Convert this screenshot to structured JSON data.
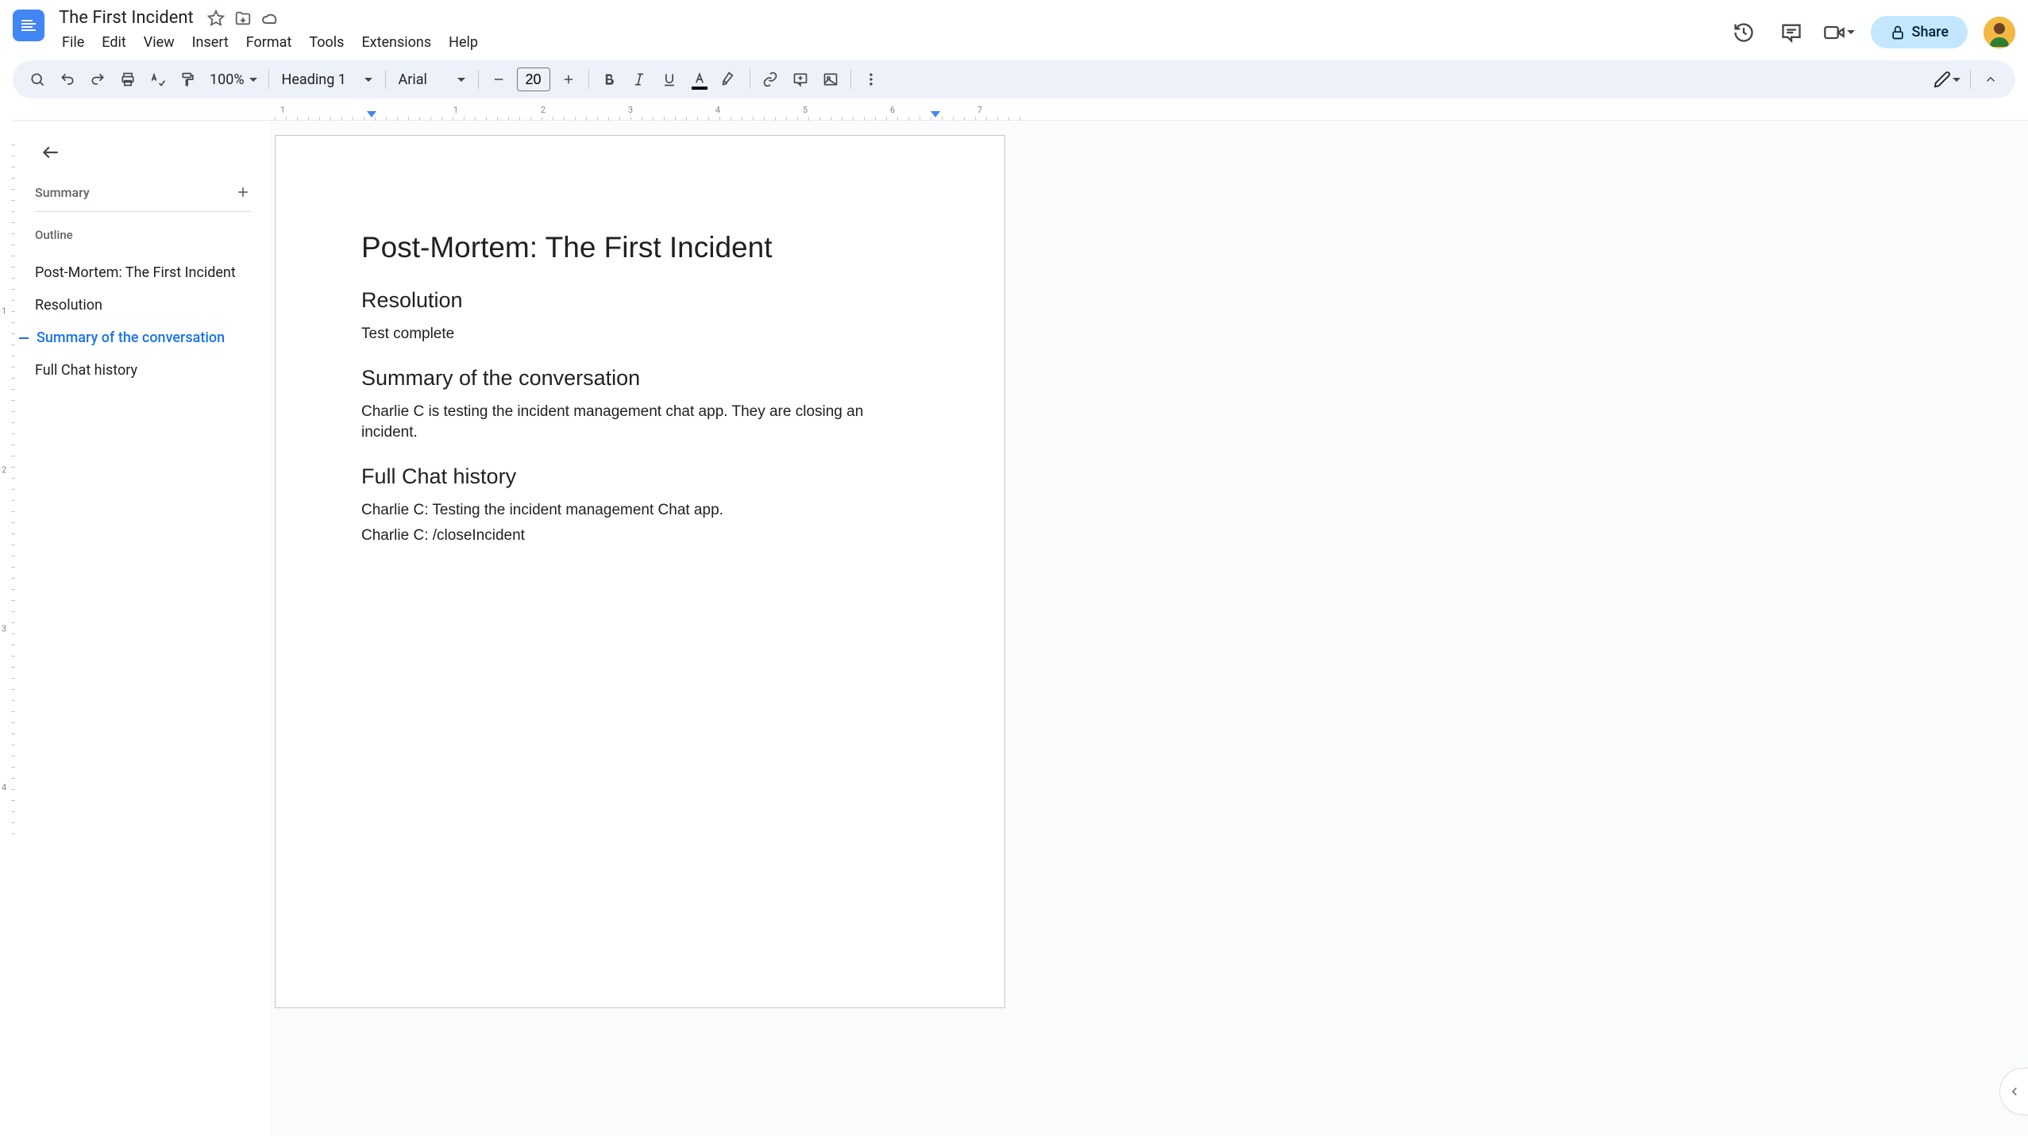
{
  "doc": {
    "title": "The First Incident"
  },
  "menubar": {
    "file": "File",
    "edit": "Edit",
    "view": "View",
    "insert": "Insert",
    "format": "Format",
    "tools": "Tools",
    "extensions": "Extensions",
    "help": "Help"
  },
  "header": {
    "share_label": "Share"
  },
  "toolbar": {
    "zoom": "100%",
    "style": "Heading 1",
    "font": "Arial",
    "font_size": "20"
  },
  "sidebar": {
    "summary_label": "Summary",
    "outline_label": "Outline",
    "items": [
      {
        "label": "Post-Mortem: The First Incident",
        "active": false
      },
      {
        "label": "Resolution",
        "active": false
      },
      {
        "label": "Summary of the conversation",
        "active": true
      },
      {
        "label": "Full Chat history",
        "active": false
      }
    ]
  },
  "content": {
    "h1": "Post-Mortem: The First Incident",
    "h2_resolution": "Resolution",
    "resolution_body": "Test complete",
    "h2_summary": "Summary of the conversation",
    "summary_body": "Charlie C is testing the incident management chat app. They are closing an incident.",
    "h2_chat": "Full Chat history",
    "chat_line1": "Charlie C: Testing the incident management Chat app.",
    "chat_line2": "Charlie C: /closeIncident"
  },
  "ruler": {
    "majors": [
      "1",
      "1",
      "2",
      "3",
      "4",
      "5",
      "6",
      "7"
    ],
    "vmajors": [
      "1",
      "2",
      "3",
      "4"
    ]
  }
}
